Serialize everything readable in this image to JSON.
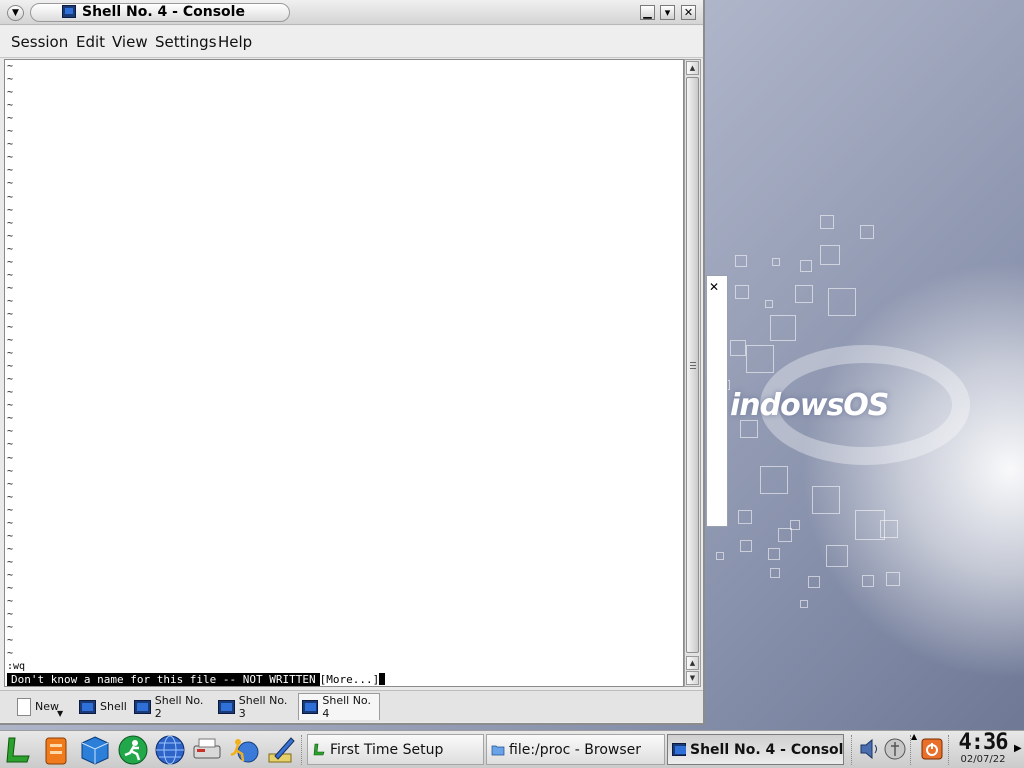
{
  "window": {
    "title": "Shell No. 4 - Console",
    "controls": {
      "minimize": "▁",
      "maximize": "▾",
      "close": "✕"
    }
  },
  "menubar": [
    "Session",
    "Edit",
    "View",
    "Settings",
    "Help"
  ],
  "terminal": {
    "tilde_char": "~",
    "command": ":wq",
    "message": "Don't know a name for this file -- NOT WRITTEN",
    "more": "[More...]"
  },
  "sessions": {
    "new_label": "New",
    "tabs": [
      "Shell",
      "Shell No. 2",
      "Shell No. 3",
      "Shell No. 4"
    ],
    "active_index": 3
  },
  "desktop": {
    "logo_text": "indowsOS",
    "ghost_close": "✕"
  },
  "taskbar": {
    "launchers": [
      "lindows-start-icon",
      "toolbox-icon",
      "cube-icon",
      "runner-icon",
      "globe-icon",
      "printer-icon",
      "click-n-run-icon",
      "pen-tool-icon"
    ],
    "tasks": [
      {
        "label": "First Time Setup",
        "icon": "lindows-icon"
      },
      {
        "label": "file:/proc - Browser",
        "icon": "folder-icon"
      },
      {
        "label": "Shell No. 4 - Console",
        "icon": "console-icon",
        "active": true
      }
    ],
    "clock": {
      "time": "4:36",
      "date": "02/07/22"
    }
  },
  "colors": {
    "accent": "#1a3a78",
    "terminal_bg": "#ffffff",
    "terminal_fg": "#000000"
  }
}
